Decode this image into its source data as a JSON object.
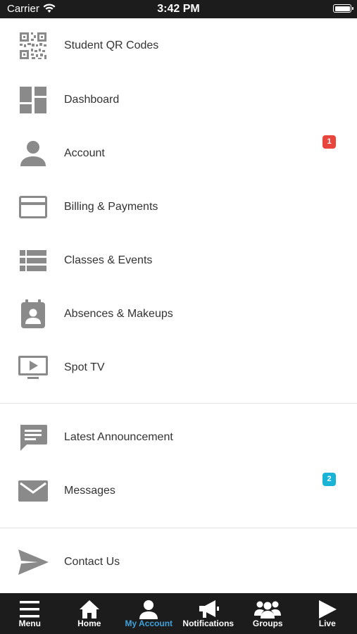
{
  "status_bar": {
    "carrier": "Carrier",
    "time": "3:42 PM"
  },
  "menu": {
    "group1": [
      {
        "label": "Student QR Codes",
        "icon": "qr-code-icon"
      },
      {
        "label": "Dashboard",
        "icon": "dashboard-icon"
      },
      {
        "label": "Account",
        "icon": "person-icon",
        "badge": "1"
      },
      {
        "label": "Billing & Payments",
        "icon": "credit-card-icon"
      },
      {
        "label": "Classes & Events",
        "icon": "list-icon"
      },
      {
        "label": "Absences & Makeups",
        "icon": "calendar-person-icon"
      },
      {
        "label": "Spot TV",
        "icon": "tv-play-icon"
      }
    ],
    "group2": [
      {
        "label": "Latest Announcement",
        "icon": "chat-bubble-icon"
      },
      {
        "label": "Messages",
        "icon": "envelope-icon",
        "badge": "2"
      }
    ],
    "group3": [
      {
        "label": "Contact Us",
        "icon": "send-icon"
      }
    ]
  },
  "colors": {
    "badge_red": "#e8453c",
    "badge_teal": "#19b3d6",
    "active_tab": "#3fa1d9",
    "icon_gray": "#8a8a8a"
  },
  "tabs": [
    {
      "label": "Menu",
      "icon": "hamburger-icon"
    },
    {
      "label": "Home",
      "icon": "home-icon"
    },
    {
      "label": "My Account",
      "icon": "person-icon",
      "active": true
    },
    {
      "label": "Notifications",
      "icon": "megaphone-icon"
    },
    {
      "label": "Groups",
      "icon": "group-icon"
    },
    {
      "label": "Live",
      "icon": "play-icon"
    }
  ]
}
